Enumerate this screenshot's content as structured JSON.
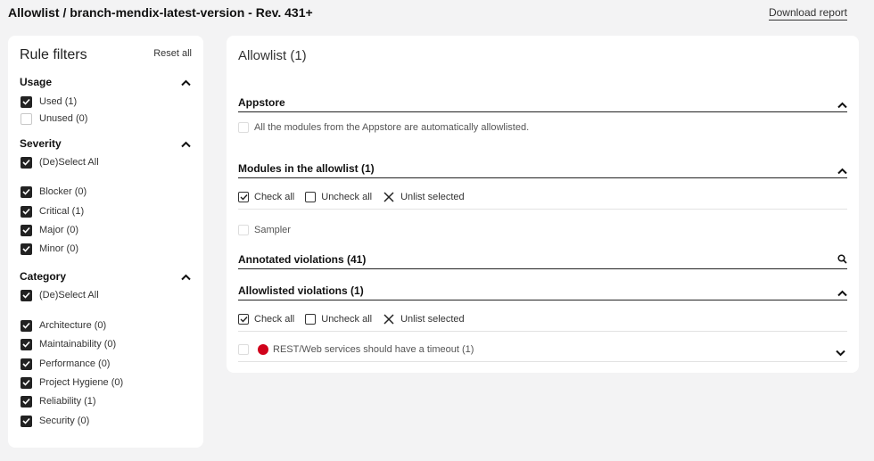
{
  "header": {
    "title": "Allowlist / branch-mendix-latest-version - Rev. 431+",
    "download_label": "Download report"
  },
  "sidebar": {
    "title": "Rule filters",
    "reset_label": "Reset all",
    "usage": {
      "heading": "Usage",
      "items": [
        {
          "label": "Used (1)",
          "checked": true
        },
        {
          "label": "Unused (0)",
          "checked": false
        }
      ]
    },
    "severity": {
      "heading": "Severity",
      "select_all": "(De)Select All",
      "items": [
        {
          "label": "Blocker (0)",
          "checked": true
        },
        {
          "label": "Critical (1)",
          "checked": true
        },
        {
          "label": "Major (0)",
          "checked": true
        },
        {
          "label": "Minor (0)",
          "checked": true
        }
      ]
    },
    "category": {
      "heading": "Category",
      "select_all": "(De)Select All",
      "items": [
        {
          "label": "Architecture (0)",
          "checked": true
        },
        {
          "label": "Maintainability (0)",
          "checked": true
        },
        {
          "label": "Performance (0)",
          "checked": true
        },
        {
          "label": "Project Hygiene (0)",
          "checked": true
        },
        {
          "label": "Reliability (1)",
          "checked": true
        },
        {
          "label": "Security (0)",
          "checked": true
        }
      ]
    }
  },
  "main": {
    "title": "Allowlist (1)",
    "appstore": {
      "heading": "Appstore",
      "note": "All the modules from the Appstore are automatically allowlisted."
    },
    "modules": {
      "heading": "Modules in the allowlist (1)",
      "check_all": "Check all",
      "uncheck_all": "Uncheck all",
      "unlist": "Unlist selected",
      "items": [
        "Sampler"
      ]
    },
    "annotated": {
      "heading": "Annotated violations (41)"
    },
    "allowlisted": {
      "heading": "Allowlisted violations (1)",
      "check_all": "Check all",
      "uncheck_all": "Uncheck all",
      "unlist": "Unlist selected",
      "items": [
        {
          "label": "REST/Web services should have a timeout (1)",
          "severity_color": "#d0021b"
        }
      ]
    }
  }
}
